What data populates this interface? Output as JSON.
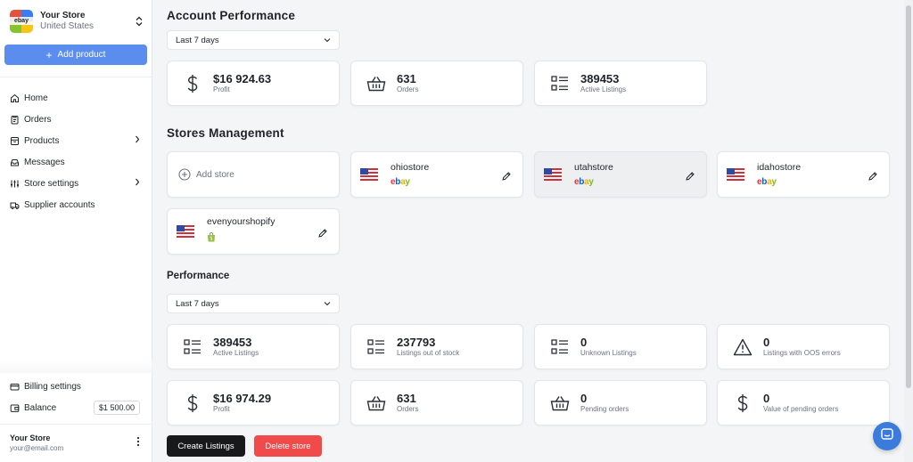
{
  "sidebar": {
    "store": {
      "logo_text": "ebay",
      "name": "Your Store",
      "country": "United States"
    },
    "add_product_label": "Add product",
    "nav": [
      {
        "label": "Home",
        "icon": "home-icon"
      },
      {
        "label": "Orders",
        "icon": "clipboard-icon"
      },
      {
        "label": "Products",
        "icon": "box-icon",
        "has_children": true
      },
      {
        "label": "Messages",
        "icon": "inbox-icon"
      },
      {
        "label": "Store settings",
        "icon": "sliders-icon",
        "has_children": true
      },
      {
        "label": "Supplier accounts",
        "icon": "truck-icon"
      }
    ],
    "billing_label": "Billing settings",
    "balance_label": "Balance",
    "balance_value": "$1 500.00",
    "user": {
      "name": "Your Store",
      "email": "your@email.com"
    }
  },
  "account_performance": {
    "title": "Account Performance",
    "period": "Last 7 days",
    "stats": [
      {
        "value": "$16 924.63",
        "label": "Profit",
        "icon": "dollar-icon"
      },
      {
        "value": "631",
        "label": "Orders",
        "icon": "basket-icon"
      },
      {
        "value": "389453",
        "label": "Active Listings",
        "icon": "list-icon"
      }
    ]
  },
  "stores_management": {
    "title": "Stores Management",
    "add_store_label": "Add store",
    "stores": [
      {
        "name": "ohiostore",
        "platform": "ebay"
      },
      {
        "name": "utahstore",
        "platform": "ebay"
      },
      {
        "name": "idahostore",
        "platform": "ebay"
      },
      {
        "name": "evenyourshopify",
        "platform": "shopify"
      }
    ]
  },
  "performance": {
    "title": "Performance",
    "period": "Last 7 days",
    "stats": [
      {
        "value": "389453",
        "label": "Active Listings",
        "icon": "list-icon"
      },
      {
        "value": "237793",
        "label": "Listings out of stock",
        "icon": "list-icon"
      },
      {
        "value": "0",
        "label": "Unknown Listings",
        "icon": "list-icon"
      },
      {
        "value": "0",
        "label": "Listings with OOS errors",
        "icon": "warning-icon"
      },
      {
        "value": "$16 974.29",
        "label": "Profit",
        "icon": "dollar-icon"
      },
      {
        "value": "631",
        "label": "Orders",
        "icon": "basket-icon"
      },
      {
        "value": "0",
        "label": "Pending orders",
        "icon": "basket-icon"
      },
      {
        "value": "0",
        "label": "Value of pending orders",
        "icon": "dollar-icon"
      }
    ]
  },
  "actions": {
    "create_label": "Create Listings",
    "delete_label": "Delete store"
  },
  "colors": {
    "primary": "#5b8def",
    "danger": "#f04a4a",
    "dark": "#18191b",
    "chat": "#3a7bdc"
  }
}
